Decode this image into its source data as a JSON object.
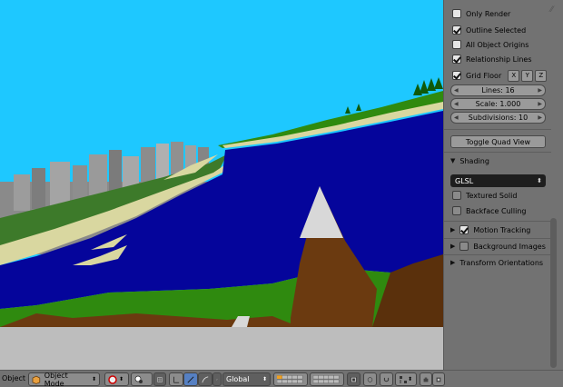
{
  "npanel": {
    "display": [
      {
        "label": "Only Render",
        "checked": false
      },
      {
        "label": "Outline Selected",
        "checked": true
      },
      {
        "label": "All Object Origins",
        "checked": false
      },
      {
        "label": "Relationship Lines",
        "checked": true
      }
    ],
    "grid_floor": {
      "label": "Grid Floor",
      "checked": true,
      "axes": [
        "X",
        "Y",
        "Z"
      ]
    },
    "lines": "Lines: 16",
    "scale": "Scale: 1.000",
    "subdivisions": "Subdivisions: 10",
    "toggle_quad_view": "Toggle Quad View",
    "shading": {
      "title": "Shading",
      "mode": "GLSL",
      "textured_solid": {
        "label": "Textured Solid",
        "checked": false
      },
      "backface_culling": {
        "label": "Backface Culling",
        "checked": false
      }
    },
    "motion_tracking": {
      "label": "Motion Tracking",
      "checked": true
    },
    "background_images": {
      "label": "Background Images",
      "checked": false
    },
    "transform_orientations": "Transform Orientations"
  },
  "header": {
    "menu": "Object",
    "mode": "Object Mode",
    "orientation": "Global"
  },
  "colors": {
    "sky": "#1ec8ff",
    "water": "#05059b",
    "grass": "#2f8a0f",
    "sand": "#d9d7a0",
    "mountain": "#6b3a10",
    "snow": "#d8d8d8",
    "panel": "#727272"
  }
}
